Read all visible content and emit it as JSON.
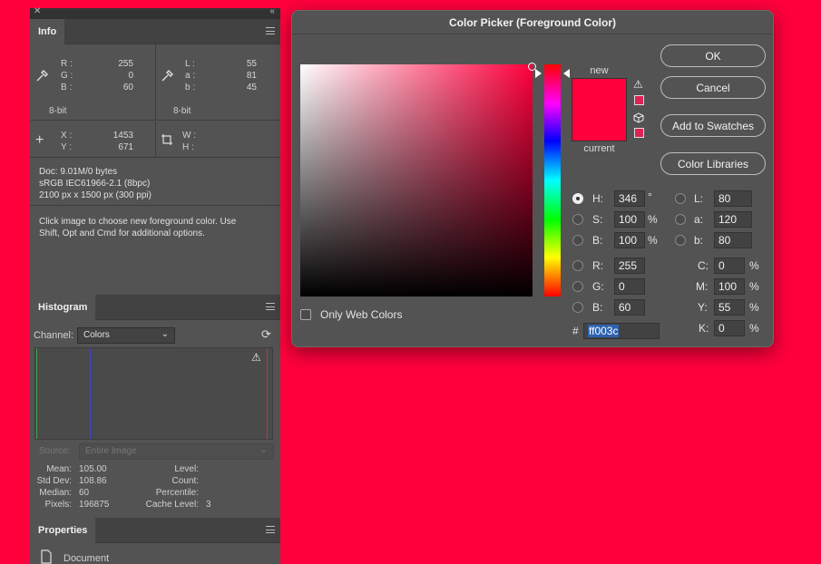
{
  "info_panel": {
    "tab": "Info",
    "rgb": {
      "r_label": "R :",
      "g_label": "G :",
      "b_label": "B :",
      "r": "255",
      "g": "0",
      "b": "60"
    },
    "lab": {
      "l_label": "L :",
      "a_label": "a :",
      "b_label": "b :",
      "l": "55",
      "a": "81",
      "b": "45"
    },
    "bitdepth_left": "8-bit",
    "bitdepth_right": "8-bit",
    "xy": {
      "x_label": "X :",
      "y_label": "Y :",
      "x": "1453",
      "y": "671"
    },
    "wh": {
      "w_label": "W :",
      "h_label": "H :"
    },
    "doc_line": "Doc: 9.01M/0 bytes",
    "profile_line": "sRGB IEC61966-2.1 (8bpc)",
    "size_line": "2100 px x 1500 px (300 ppi)",
    "hint_line1": "Click image to choose new foreground color.  Use",
    "hint_line2": "Shift, Opt and Cmd for additional options."
  },
  "histogram_panel": {
    "tab": "Histogram",
    "channel_label": "Channel:",
    "channel_value": "Colors",
    "source_label": "Source:",
    "source_value": "Entire Image",
    "stats_left": [
      {
        "label": "Mean:",
        "value": "105.00"
      },
      {
        "label": "Std Dev:",
        "value": "108.86"
      },
      {
        "label": "Median:",
        "value": "60"
      },
      {
        "label": "Pixels:",
        "value": "196875"
      }
    ],
    "stats_right": [
      {
        "label": "Level:",
        "value": ""
      },
      {
        "label": "Count:",
        "value": ""
      },
      {
        "label": "Percentile:",
        "value": ""
      },
      {
        "label": "Cache Level:",
        "value": "3"
      }
    ]
  },
  "properties_panel": {
    "tab": "Properties",
    "item": "Document"
  },
  "color_picker": {
    "title": "Color Picker (Foreground Color)",
    "label_new": "new",
    "label_current": "current",
    "new_color": "#ff003c",
    "current_color": "#ff003c",
    "buttons": {
      "ok": "OK",
      "cancel": "Cancel",
      "add_swatches": "Add to Swatches",
      "color_libraries": "Color Libraries"
    },
    "only_web_colors": "Only Web Colors",
    "hsb": {
      "h_label": "H:",
      "h": "346",
      "h_unit": "°",
      "s_label": "S:",
      "s": "100",
      "s_unit": "%",
      "b_label": "B:",
      "b": "100",
      "b_unit": "%"
    },
    "rgb": {
      "r_label": "R:",
      "r": "255",
      "g_label": "G:",
      "g": "0",
      "b_label": "B:",
      "b": "60"
    },
    "lab": {
      "l_label": "L:",
      "l": "80",
      "a_label": "a:",
      "a": "120",
      "b_label": "b:",
      "b": "80"
    },
    "cmyk": {
      "c_label": "C:",
      "c": "0",
      "c_unit": "%",
      "m_label": "M:",
      "m": "100",
      "m_unit": "%",
      "y_label": "Y:",
      "y": "55",
      "y_unit": "%",
      "k_label": "K:",
      "k": "0",
      "k_unit": "%"
    },
    "hex_label": "#",
    "hex": "ff003c"
  }
}
